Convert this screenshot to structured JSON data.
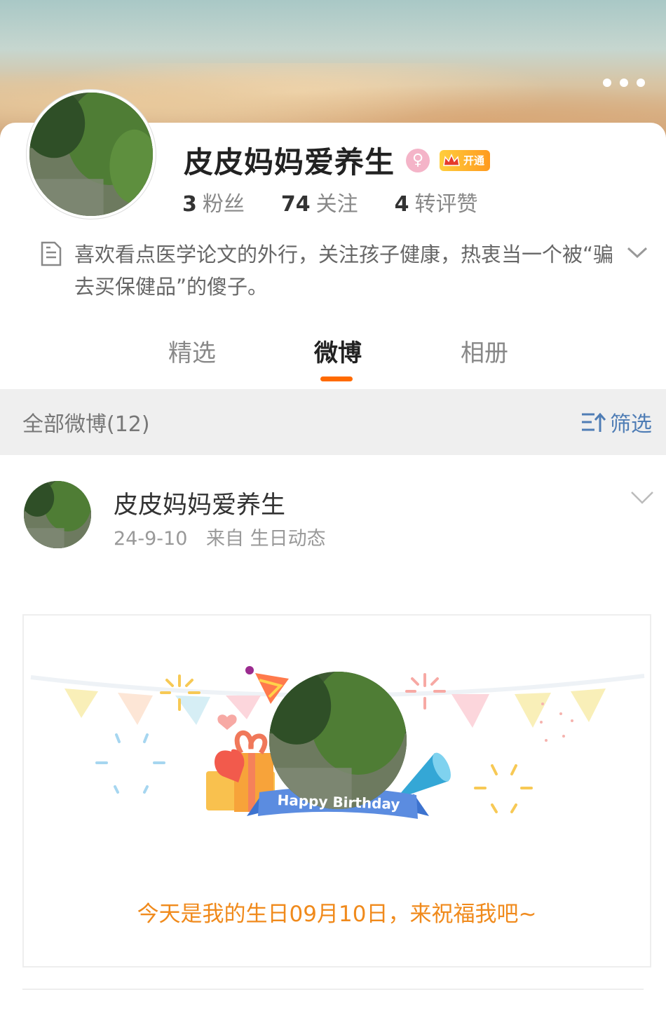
{
  "profile": {
    "name": "皮皮妈妈爱养生",
    "vip_label": "开通",
    "stats": [
      {
        "num": "3",
        "label": "粉丝"
      },
      {
        "num": "74",
        "label": "关注"
      },
      {
        "num": "4",
        "label": "转评赞"
      }
    ],
    "bio": "喜欢看点医学论文的外行，关注孩子健康，热衷当一个被“骗去买保健品”的傻子。"
  },
  "tabs": [
    {
      "label": "精选"
    },
    {
      "label": "微博"
    },
    {
      "label": "相册"
    }
  ],
  "filter": {
    "title": "全部微博(12)",
    "button_label": "筛选"
  },
  "post": {
    "author": "皮皮妈妈爱养生",
    "date": "24-9-10",
    "source": "来自 生日动态",
    "banner_text": "Happy Birthday",
    "message": "今天是我的生日09月10日，来祝福我吧~"
  },
  "colors": {
    "accent": "#ff6a00",
    "link": "#4f7db5",
    "birthday_text": "#f08a1c"
  }
}
